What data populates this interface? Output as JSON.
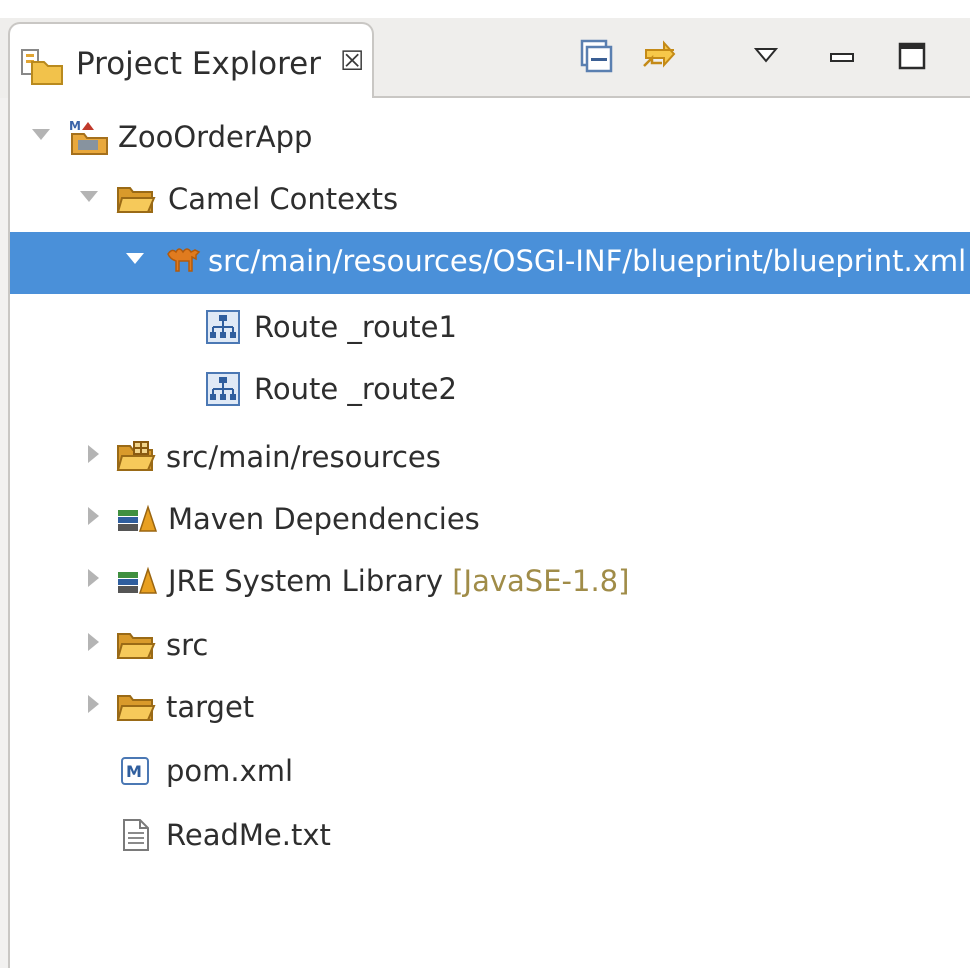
{
  "panel": {
    "title": "Project Explorer",
    "close_glyph": "☒",
    "title_icon": "package-explorer-icon"
  },
  "toolbar": {
    "collapse_all": "collapse-all-icon",
    "link_with_editor": "link-with-editor-icon",
    "view_menu": "view-menu-icon",
    "minimize": "minimize-icon",
    "maximize": "maximize-icon"
  },
  "tree": {
    "project": {
      "label": "ZooOrderApp",
      "icon": "maven-project-icon",
      "expanded": true
    },
    "camel_contexts": {
      "label": "Camel Contexts",
      "icon": "folder-open-icon",
      "expanded": true
    },
    "blueprint": {
      "label": "src/main/resources/OSGI-INF/blueprint/blueprint.xml",
      "icon": "camel-icon",
      "expanded": true,
      "selected": true
    },
    "route1": {
      "label": "Route _route1",
      "icon": "route-icon"
    },
    "route2": {
      "label": "Route _route2",
      "icon": "route-icon"
    },
    "resources": {
      "label": "src/main/resources",
      "icon": "source-folder-icon",
      "expanded": false
    },
    "maven_deps": {
      "label": "Maven Dependencies",
      "icon": "library-icon",
      "expanded": false
    },
    "jre": {
      "label": "JRE System Library",
      "decoration": "[JavaSE-1.8]",
      "icon": "library-icon",
      "expanded": false
    },
    "src": {
      "label": "src",
      "icon": "folder-icon",
      "expanded": false
    },
    "target": {
      "label": "target",
      "icon": "folder-icon",
      "expanded": false
    },
    "pom": {
      "label": "pom.xml",
      "icon": "maven-file-icon"
    },
    "readme": {
      "label": "ReadMe.txt",
      "icon": "text-file-icon"
    }
  },
  "colors": {
    "selection": "#4a90d9",
    "decoration_text": "#a08c48",
    "background": "#ffffff"
  }
}
